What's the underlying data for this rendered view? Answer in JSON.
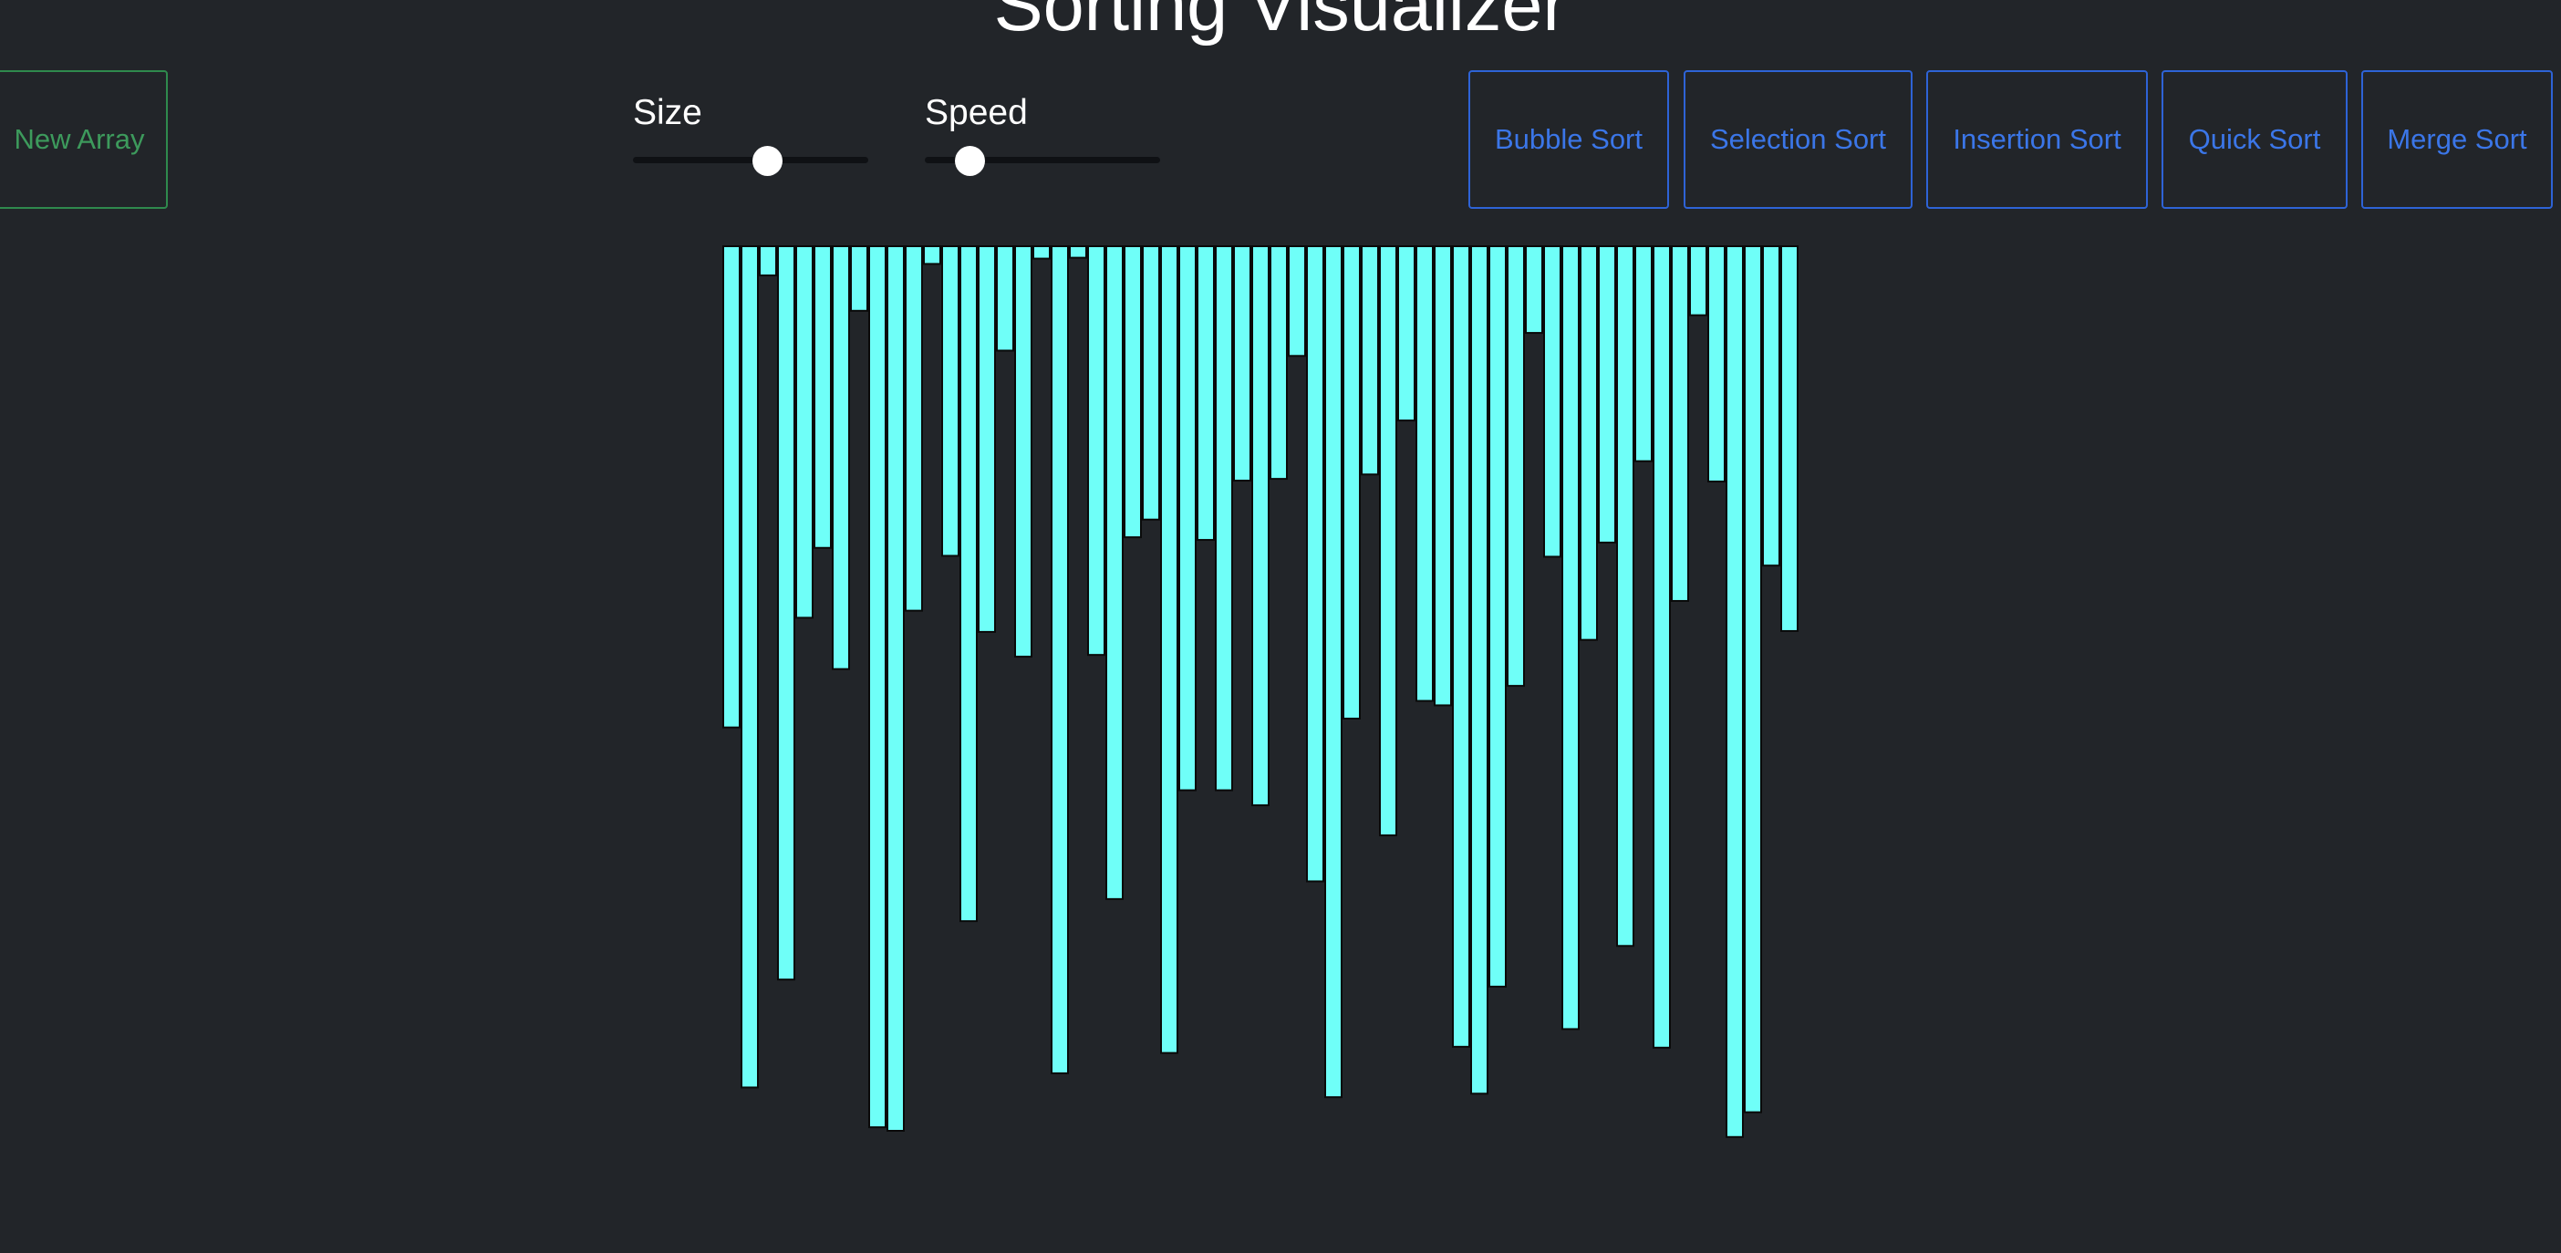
{
  "app": {
    "title": "Sorting Visualizer"
  },
  "toolbar": {
    "new_array_label": "New Array",
    "size_label": "Size",
    "speed_label": "Speed",
    "size_value": 0.57,
    "speed_value": 0.19,
    "sort_buttons": [
      "Bubble Sort",
      "Selection Sort",
      "Insertion Sort",
      "Quick Sort",
      "Merge Sort"
    ]
  },
  "colors": {
    "bar_fill": "#6ffff8",
    "bar_stroke": "#0a0a0a",
    "background": "#222529",
    "new_array_accent": "#3d9a5c",
    "sort_button_accent": "#3b76e8"
  },
  "chart_data": {
    "type": "bar",
    "bar_count": 60,
    "ylim": [
      0,
      1000
    ],
    "values": [
      544,
      951,
      33,
      829,
      420,
      341,
      478,
      73,
      996,
      1000,
      412,
      20,
      350,
      763,
      436,
      118,
      464,
      14,
      935,
      13,
      462,
      738,
      329,
      309,
      912,
      615,
      332,
      615,
      265,
      632,
      263,
      124,
      718,
      962,
      534,
      258,
      666,
      197,
      514,
      519,
      905,
      958,
      837,
      497,
      98,
      351,
      885,
      445,
      335,
      791,
      243,
      906,
      401,
      78,
      266,
      1007,
      979,
      361,
      435
    ]
  }
}
